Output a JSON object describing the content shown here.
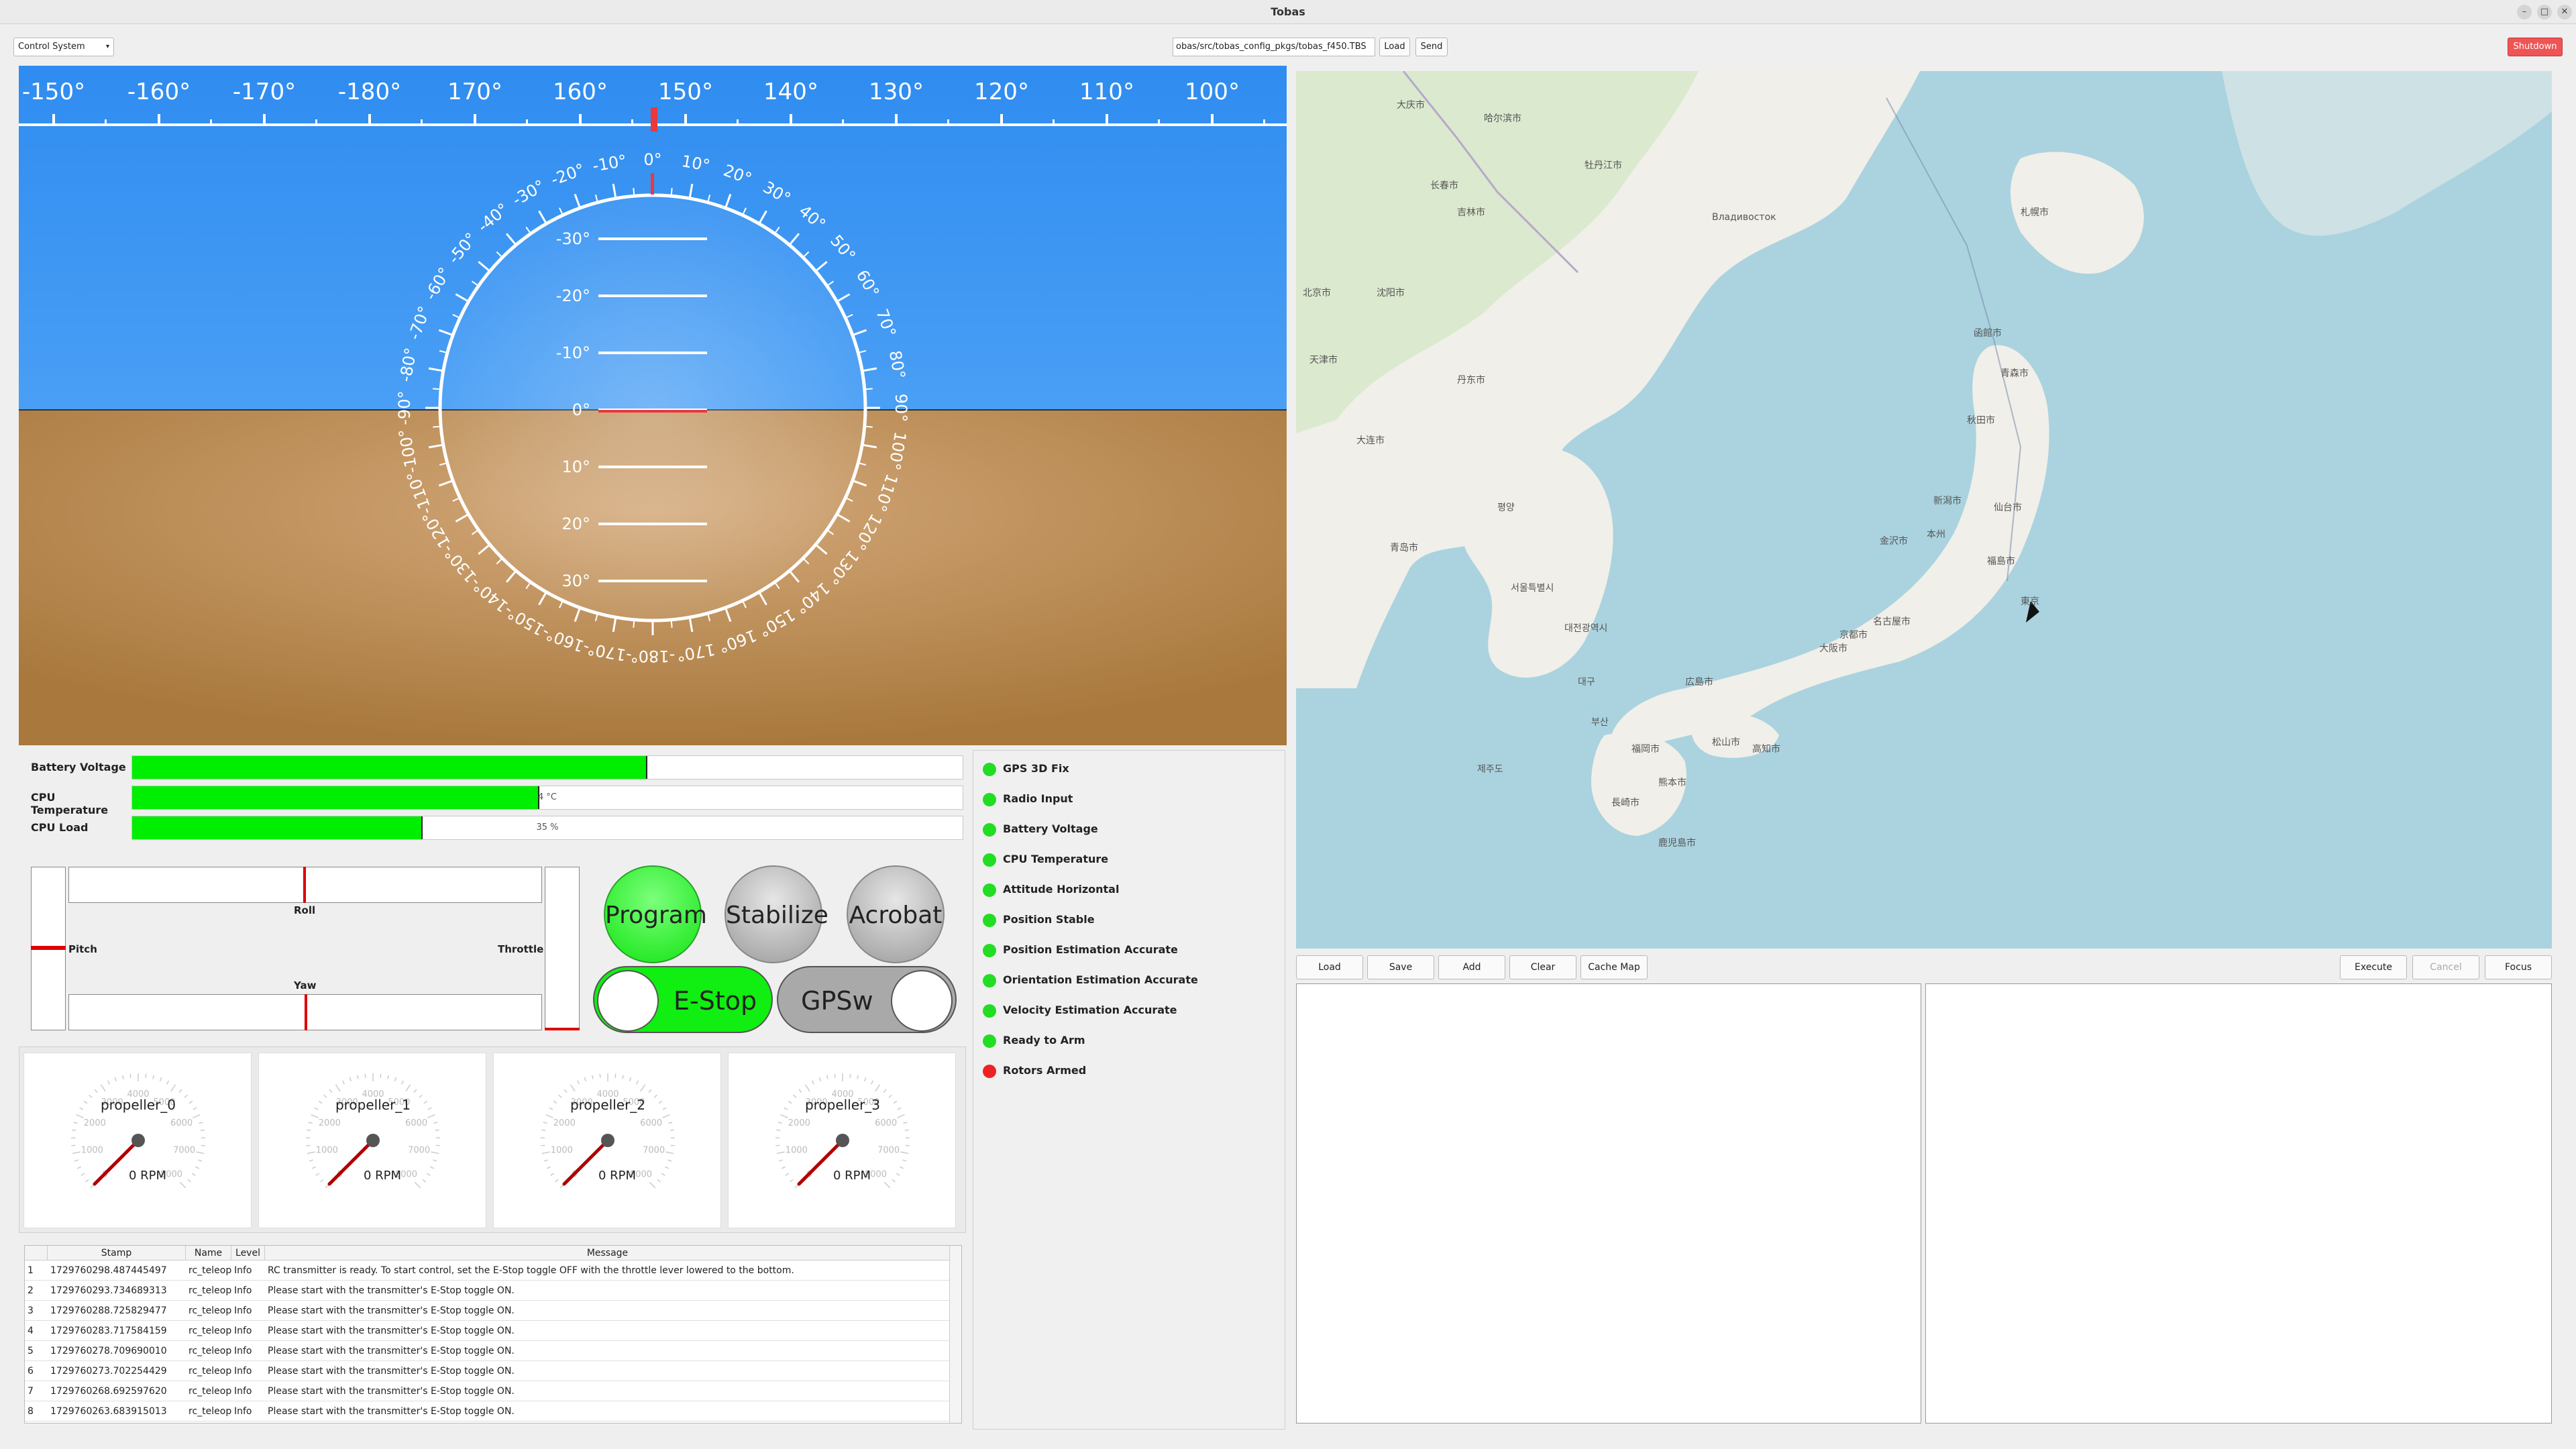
{
  "window": {
    "title": "Tobas"
  },
  "toolbar": {
    "system_select": "Control System",
    "config_path": "obas/src/tobas_config_pkgs/tobas_f450.TBS",
    "load_label": "Load",
    "send_label": "Send",
    "shutdown_label": "Shutdown"
  },
  "colors": {
    "sky": "#2f8cf0",
    "ground": "#b98a4e",
    "ok_led": "#22dd22",
    "error_led": "#ee2222",
    "bar_fill": "#00ee00",
    "shutdown": "#ee5555"
  },
  "attitude": {
    "heading_ticks": [
      "-150°",
      "-160°",
      "-170°",
      "-180°",
      "170°",
      "160°",
      "150°",
      "140°",
      "130°",
      "120°",
      "110°",
      "100°"
    ],
    "pitch_labels": [
      "-30°",
      "-20°",
      "-10°",
      "0°",
      "10°",
      "20°",
      "30°"
    ],
    "roll_labels": [
      "-10°",
      "-20°",
      "-30°",
      "-40°",
      "-50°",
      "-60°",
      "-70°",
      "-80°",
      "-90°",
      "-100°",
      "-110°",
      "-120°",
      "-130°",
      "-140°",
      "-150°",
      "-160°",
      "-170°",
      "-180°",
      "170°",
      "160°",
      "150°",
      "140°",
      "130°",
      "120°",
      "110°",
      "100°",
      "90°",
      "80°",
      "70°",
      "60°",
      "50°",
      "40°",
      "30°",
      "20°",
      "10°",
      "0°"
    ]
  },
  "bars": [
    {
      "label": "Battery Voltage",
      "value_text": "",
      "fraction": 0.62
    },
    {
      "label": "CPU Temperature",
      "value_text": "4 °C",
      "fraction": 0.49
    },
    {
      "label": "CPU Load",
      "value_text": "35 %",
      "fraction": 0.35
    }
  ],
  "sticks": {
    "roll": "Roll",
    "pitch": "Pitch",
    "throttle": "Throttle",
    "yaw": "Yaw"
  },
  "modes": {
    "program": "Program",
    "stabilize": "Stabilize",
    "acrobat": "Acrobat",
    "estop": "E-Stop",
    "gpsw": "GPSw"
  },
  "status": [
    {
      "label": "GPS 3D Fix",
      "ok": true
    },
    {
      "label": "Radio Input",
      "ok": true
    },
    {
      "label": "Battery Voltage",
      "ok": true
    },
    {
      "label": "CPU Temperature",
      "ok": true
    },
    {
      "label": "Attitude Horizontal",
      "ok": true
    },
    {
      "label": "Position Stable",
      "ok": true
    },
    {
      "label": "Position Estimation Accurate",
      "ok": true
    },
    {
      "label": "Orientation Estimation Accurate",
      "ok": true
    },
    {
      "label": "Velocity Estimation Accurate",
      "ok": true
    },
    {
      "label": "Ready to Arm",
      "ok": true
    },
    {
      "label": "Rotors Armed",
      "ok": false
    }
  ],
  "gauges": [
    {
      "name": "propeller_0",
      "rpm_text": "0 RPM",
      "rpm": 0
    },
    {
      "name": "propeller_1",
      "rpm_text": "0 RPM",
      "rpm": 0
    },
    {
      "name": "propeller_2",
      "rpm_text": "0 RPM",
      "rpm": 0
    },
    {
      "name": "propeller_3",
      "rpm_text": "0 RPM",
      "rpm": 0
    }
  ],
  "gauge_scale": [
    "0",
    "1000",
    "2000",
    "3000",
    "4000",
    "5000",
    "6000",
    "7000",
    "8000"
  ],
  "log": {
    "columns": [
      "Stamp",
      "Name",
      "Level",
      "Message"
    ],
    "rows": [
      {
        "n": "1",
        "stamp": "1729760298.487445497",
        "name": "rc_teleop",
        "level": "Info",
        "msg": "RC transmitter is ready. To start control, set the E-Stop toggle OFF with the throttle lever lowered to the bottom."
      },
      {
        "n": "2",
        "stamp": "1729760293.734689313",
        "name": "rc_teleop",
        "level": "Info",
        "msg": "Please start with the transmitter's E-Stop toggle ON."
      },
      {
        "n": "3",
        "stamp": "1729760288.725829477",
        "name": "rc_teleop",
        "level": "Info",
        "msg": "Please start with the transmitter's E-Stop toggle ON."
      },
      {
        "n": "4",
        "stamp": "1729760283.717584159",
        "name": "rc_teleop",
        "level": "Info",
        "msg": "Please start with the transmitter's E-Stop toggle ON."
      },
      {
        "n": "5",
        "stamp": "1729760278.709690010",
        "name": "rc_teleop",
        "level": "Info",
        "msg": "Please start with the transmitter's E-Stop toggle ON."
      },
      {
        "n": "6",
        "stamp": "1729760273.702254429",
        "name": "rc_teleop",
        "level": "Info",
        "msg": "Please start with the transmitter's E-Stop toggle ON."
      },
      {
        "n": "7",
        "stamp": "1729760268.692597620",
        "name": "rc_teleop",
        "level": "Info",
        "msg": "Please start with the transmitter's E-Stop toggle ON."
      },
      {
        "n": "8",
        "stamp": "1729760263.683915013",
        "name": "rc_teleop",
        "level": "Info",
        "msg": "Please start with the transmitter's E-Stop toggle ON."
      }
    ]
  },
  "map": {
    "labels": [
      "大庆市",
      "哈尔滨市",
      "长春市",
      "吉林市",
      "牡丹江市",
      "沈阳市",
      "丹东市",
      "大连市",
      "北京市",
      "天津市",
      "青岛市",
      "평양",
      "서울특별시",
      "대전광역시",
      "대구",
      "부산",
      "제주도",
      "Владивосток",
      "札幌市",
      "函館市",
      "青森市",
      "秋田市",
      "仙台市",
      "福島市",
      "新潟市",
      "本州",
      "東京",
      "名古屋市",
      "大阪市",
      "京都市",
      "広島市",
      "福岡市",
      "長崎市",
      "熊本市",
      "鹿児島市",
      "松山市",
      "高知市",
      "金沢市"
    ],
    "buttons": [
      "Load",
      "Save",
      "Add",
      "Clear",
      "Cache Map"
    ],
    "right_buttons": [
      "Execute",
      "Cancel",
      "Focus"
    ]
  }
}
